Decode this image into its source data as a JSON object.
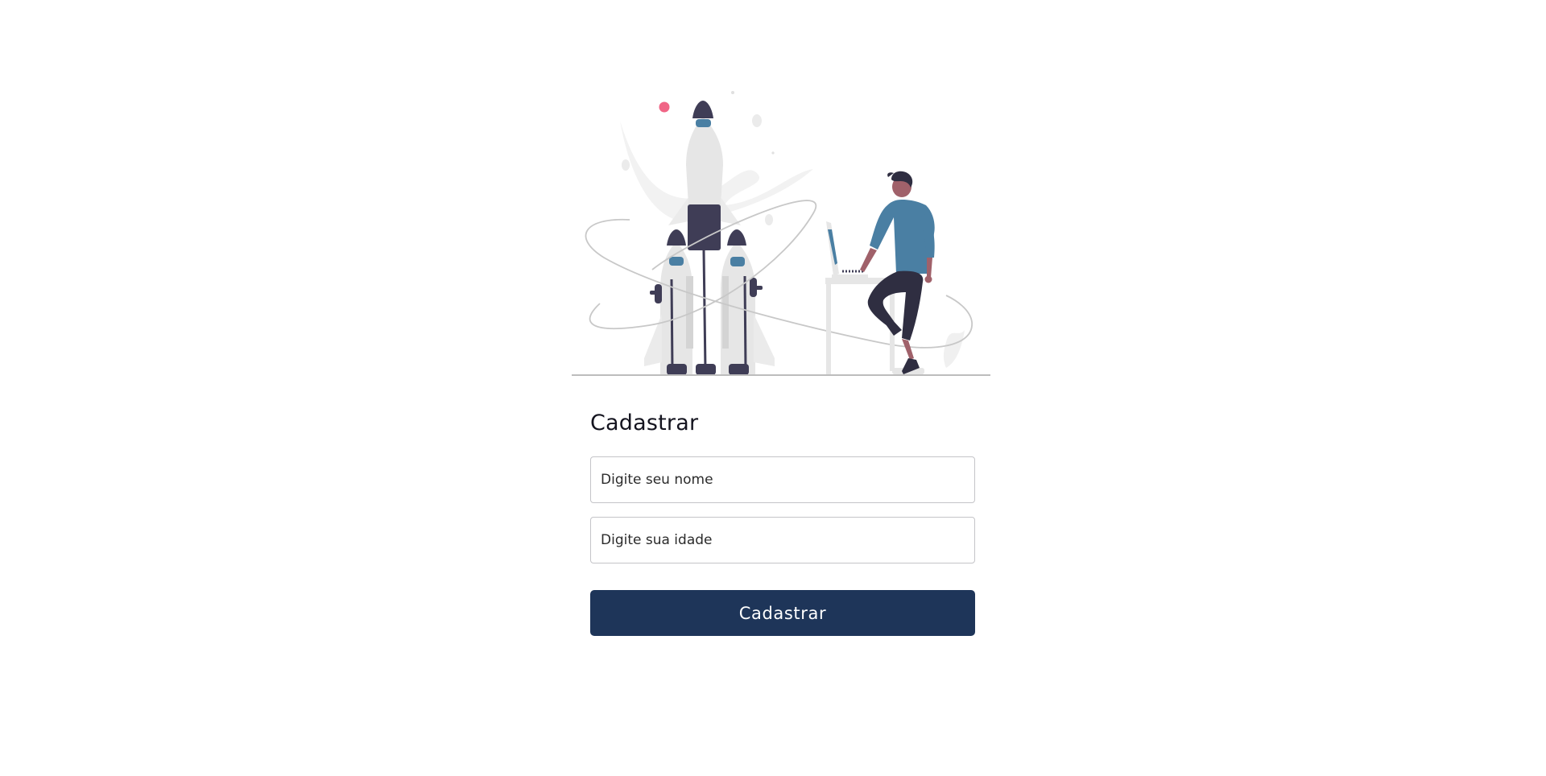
{
  "form": {
    "title": "Cadastrar",
    "name_field": {
      "placeholder": "Digite seu nome",
      "value": ""
    },
    "age_field": {
      "placeholder": "Digite sua idade",
      "value": ""
    },
    "submit_label": "Cadastrar"
  },
  "colors": {
    "button_bg": "#1e3559",
    "accent_blue": "#4a7fa3",
    "dark_purple": "#3f3d56",
    "accent_pink": "#f06586",
    "light_gray": "#e6e6e6",
    "skin": "#a0616a"
  },
  "illustration": {
    "name": "rocket-launch-illustration"
  }
}
